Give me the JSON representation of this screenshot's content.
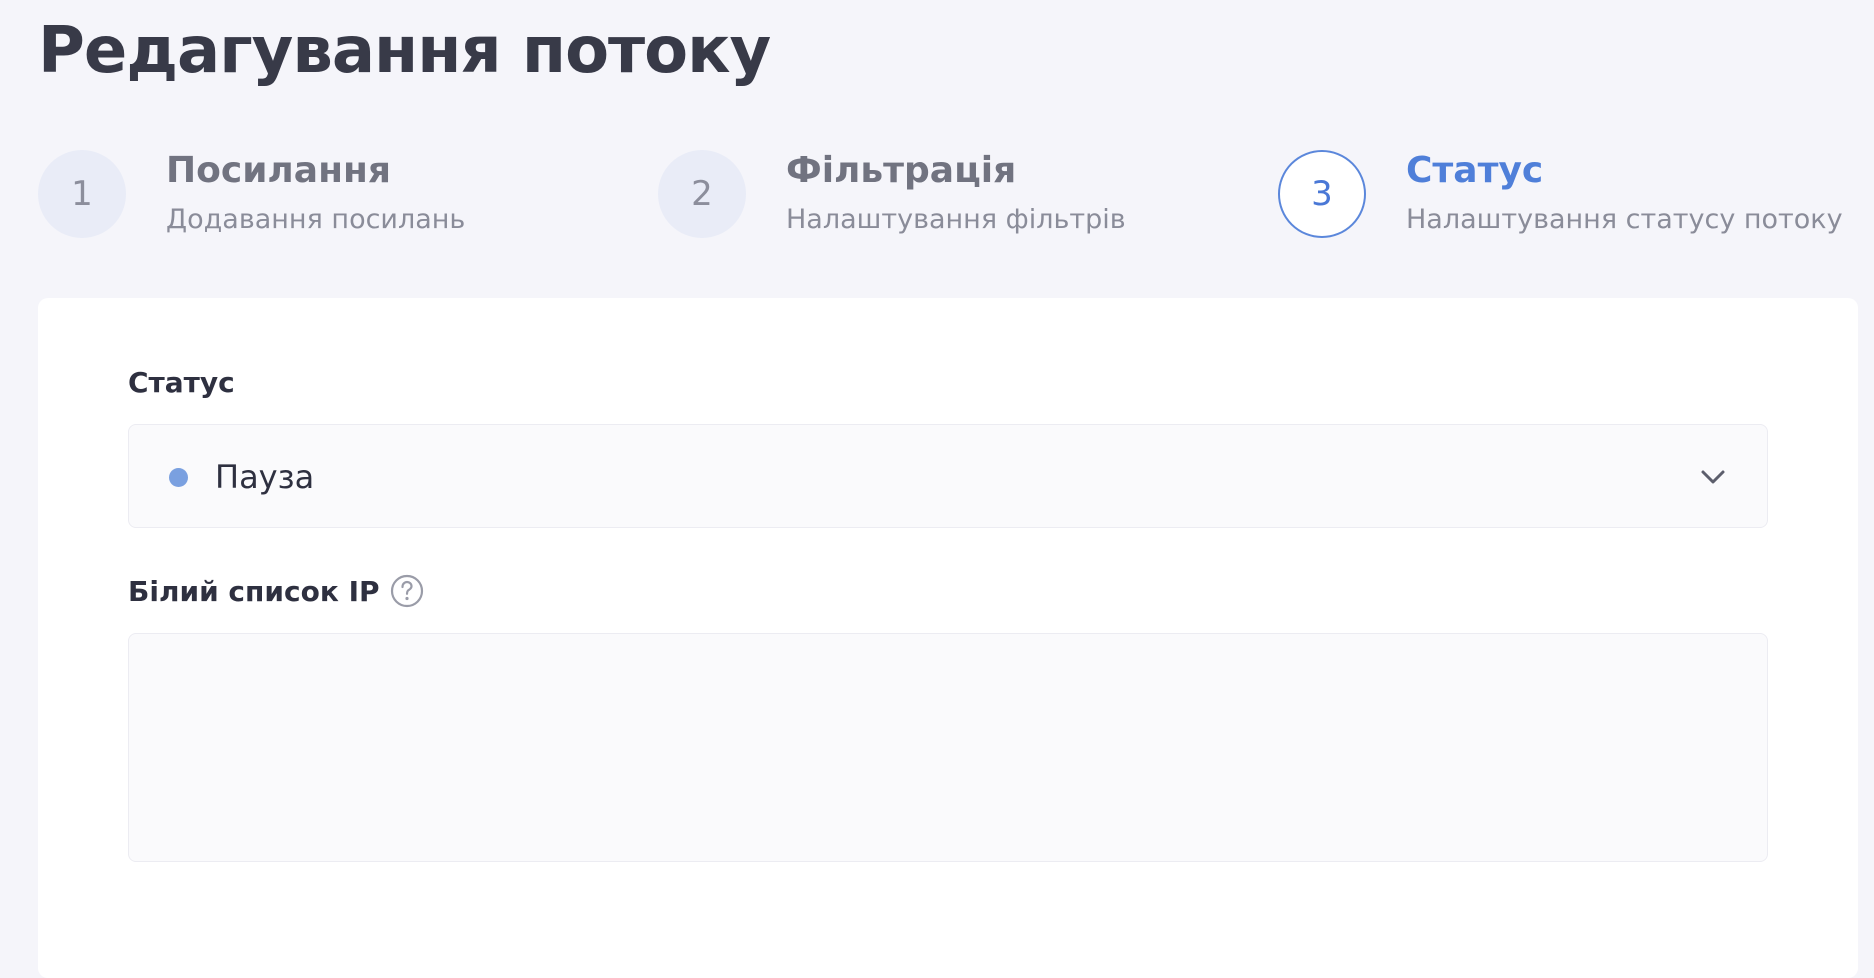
{
  "page": {
    "title": "Редагування потоку"
  },
  "steps": [
    {
      "number": "1",
      "title": "Посилання",
      "subtitle": "Додавання посилань",
      "active": false
    },
    {
      "number": "2",
      "title": "Фільтрація",
      "subtitle": "Налаштування фільтрів",
      "active": false
    },
    {
      "number": "3",
      "title": "Статус",
      "subtitle": "Налаштування статусу потоку",
      "active": true
    }
  ],
  "form": {
    "status_label": "Статус",
    "status_value": "Пауза",
    "status_dot_color": "#7aa0e0",
    "whitelist_label": "Білий список IP",
    "whitelist_value": "",
    "help_icon": "question-circle-icon",
    "dropdown_icon": "chevron-down-icon"
  },
  "colors": {
    "accent": "#4f7fd9",
    "background": "#f5f5fa",
    "card": "#ffffff"
  }
}
